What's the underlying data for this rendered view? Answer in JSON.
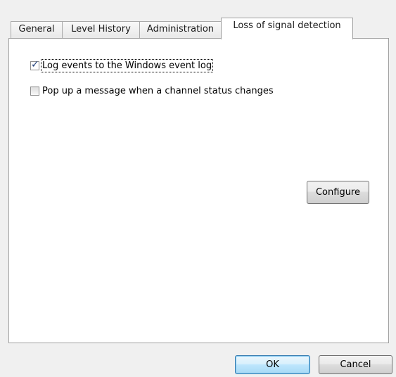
{
  "tabs": [
    {
      "label": "General",
      "active": false
    },
    {
      "label": "Level History",
      "active": false
    },
    {
      "label": "Administration",
      "active": false
    },
    {
      "label": "Loss of signal detection",
      "active": true
    }
  ],
  "options": [
    {
      "label": "Log events to the Windows event log",
      "checked": true
    },
    {
      "label": "Pop up a message when a channel status changes",
      "checked": false
    }
  ],
  "configure_label": "Configure",
  "ok_label": "OK",
  "cancel_label": "Cancel"
}
